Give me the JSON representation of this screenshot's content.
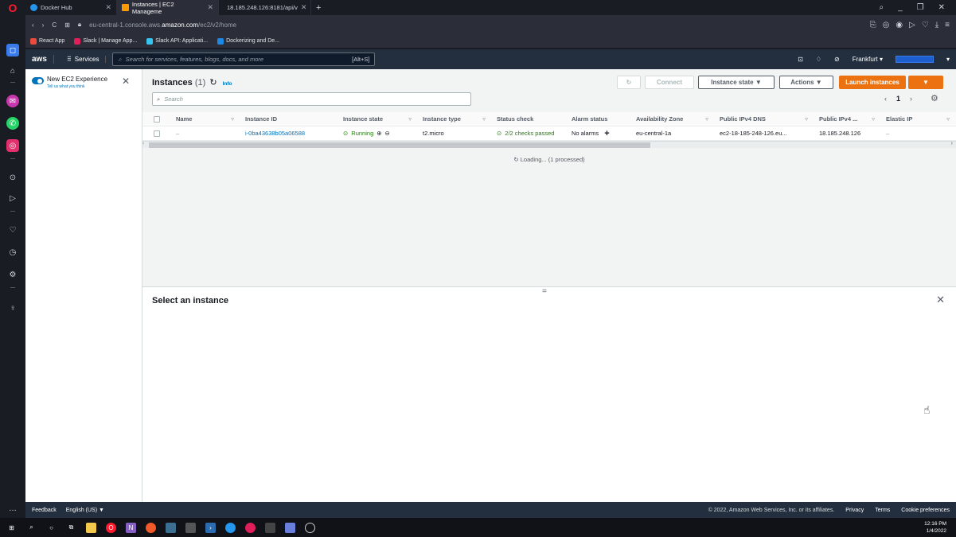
{
  "browser": {
    "tabs": [
      {
        "label": "Docker Hub",
        "active": false
      },
      {
        "label": "Instances | EC2 Manageme",
        "active": true
      },
      {
        "label": "18.185.248.126:8181/api/v",
        "active": false
      }
    ],
    "address": {
      "prefix": "eu-central-1.console.aws.",
      "domain": "amazon.com",
      "path": "/ec2/v2/home"
    },
    "bookmarks": [
      "React App",
      "Slack | Manage App...",
      "Slack API: Applicati...",
      "Dockerizing and De..."
    ]
  },
  "aws_nav": {
    "logo": "aws",
    "services_label": "Services",
    "search_placeholder": "Search for services, features, blogs, docs, and more",
    "search_shortcut": "[Alt+S]",
    "region": "Frankfurt ▾"
  },
  "left_panel": {
    "new_experience": "New EC2 Experience",
    "tell_us": "Tell us what you think"
  },
  "instances": {
    "title": "Instances",
    "count": "(1)",
    "info": "Info",
    "buttons": {
      "connect": "Connect",
      "instance_state": "Instance state ▼",
      "actions": "Actions ▼",
      "launch": "Launch instances",
      "launch_caret": "▼"
    },
    "search_placeholder": "Search",
    "page": "1",
    "columns": [
      "Name",
      "Instance ID",
      "Instance state",
      "Instance type",
      "Status check",
      "Alarm status",
      "Availability Zone",
      "Public IPv4 DNS",
      "Public IPv4 ...",
      "Elastic IP"
    ],
    "rows": [
      {
        "name": "–",
        "instance_id": "i-0ba43638b05a06588",
        "state": "Running",
        "type": "t2.micro",
        "status": "2/2 checks passed",
        "alarm": "No alarms",
        "az": "eu-central-1a",
        "dns": "ec2-18-185-248-126.eu...",
        "ipv4": "18.185.248.126",
        "eip": "–"
      }
    ],
    "loading": "Loading... (1 processed)"
  },
  "detail": {
    "title": "Select an instance"
  },
  "footer": {
    "feedback": "Feedback",
    "language": "English (US) ▼",
    "copyright": "© 2022, Amazon Web Services, Inc. or its affiliates.",
    "privacy": "Privacy",
    "terms": "Terms",
    "cookies": "Cookie preferences"
  },
  "taskbar": {
    "time": "12:16 PM",
    "date": "1/4/2022"
  },
  "colors": {
    "aws_nav": "#232f3e",
    "launch_orange": "#ec7211",
    "link_blue": "#0073bb",
    "running_green": "#1d8102"
  }
}
